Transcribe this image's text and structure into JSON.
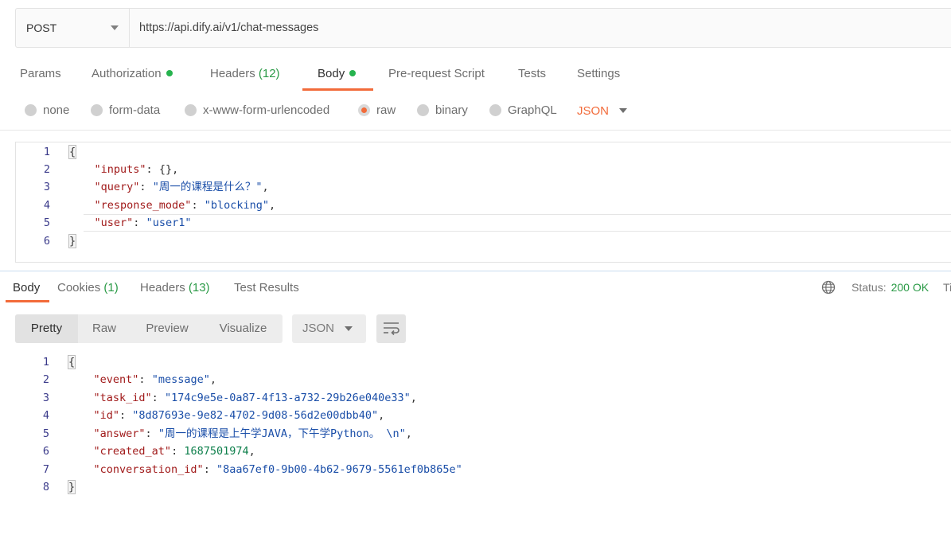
{
  "request": {
    "method": "POST",
    "url": "https://api.dify.ai/v1/chat-messages"
  },
  "request_tabs": [
    {
      "label": "Params",
      "count": "",
      "dot": false,
      "active": false
    },
    {
      "label": "Authorization",
      "count": "",
      "dot": true,
      "active": false
    },
    {
      "label": "Headers",
      "count": "(12)",
      "dot": false,
      "active": false
    },
    {
      "label": "Body",
      "count": "",
      "dot": true,
      "active": true
    },
    {
      "label": "Pre-request Script",
      "count": "",
      "dot": false,
      "active": false
    },
    {
      "label": "Tests",
      "count": "",
      "dot": false,
      "active": false
    },
    {
      "label": "Settings",
      "count": "",
      "dot": false,
      "active": false
    }
  ],
  "body_types": [
    {
      "label": "none",
      "selected": false
    },
    {
      "label": "form-data",
      "selected": false
    },
    {
      "label": "x-www-form-urlencoded",
      "selected": false
    },
    {
      "label": "raw",
      "selected": true
    },
    {
      "label": "binary",
      "selected": false
    },
    {
      "label": "GraphQL",
      "selected": false
    }
  ],
  "body_format": "JSON",
  "request_body": {
    "line_numbers": [
      "1",
      "2",
      "3",
      "4",
      "5",
      "6"
    ],
    "lines": [
      {
        "open": "{"
      },
      {
        "key": "\"inputs\"",
        "sep": ": ",
        "value": "{}",
        "value_type": "p",
        "end": ","
      },
      {
        "key": "\"query\"",
        "sep": ": ",
        "value": "\"周一的课程是什么？\"",
        "value_type": "s",
        "end": ","
      },
      {
        "key": "\"response_mode\"",
        "sep": ": ",
        "value": "\"blocking\"",
        "value_type": "s",
        "end": ","
      },
      {
        "key": "\"user\"",
        "sep": ": ",
        "value": "\"user1\"",
        "value_type": "s",
        "end": ""
      },
      {
        "close": "}"
      }
    ]
  },
  "response_tabs": [
    {
      "label": "Body",
      "count": "",
      "active": true
    },
    {
      "label": "Cookies",
      "count": "(1)",
      "active": false
    },
    {
      "label": "Headers",
      "count": "(13)",
      "active": false
    },
    {
      "label": "Test Results",
      "count": "",
      "active": false
    }
  ],
  "status": {
    "label": "Status:",
    "value": "200 OK",
    "time_label": "Ti"
  },
  "view_modes": [
    "Pretty",
    "Raw",
    "Preview",
    "Visualize"
  ],
  "active_view": "Pretty",
  "response_format": "JSON",
  "response_body": {
    "line_numbers": [
      "1",
      "2",
      "3",
      "4",
      "5",
      "6",
      "7",
      "8"
    ],
    "lines": [
      {
        "open": "{"
      },
      {
        "key": "\"event\"",
        "sep": ": ",
        "value": "\"message\"",
        "value_type": "s",
        "end": ","
      },
      {
        "key": "\"task_id\"",
        "sep": ": ",
        "value": "\"174c9e5e-0a87-4f13-a732-29b26e040e33\"",
        "value_type": "s",
        "end": ","
      },
      {
        "key": "\"id\"",
        "sep": ": ",
        "value": "\"8d87693e-9e82-4702-9d08-56d2e00dbb40\"",
        "value_type": "s",
        "end": ","
      },
      {
        "key": "\"answer\"",
        "sep": ": ",
        "value": "\"周一的课程是上午学JAVA，下午学Python。 \\n\"",
        "value_type": "s",
        "end": ","
      },
      {
        "key": "\"created_at\"",
        "sep": ": ",
        "value": "1687501974",
        "value_type": "n",
        "end": ","
      },
      {
        "key": "\"conversation_id\"",
        "sep": ": ",
        "value": "\"8aa67ef0-9b00-4b62-9679-5561ef0b865e\"",
        "value_type": "s",
        "end": ""
      },
      {
        "close": "}"
      }
    ]
  },
  "colors": {
    "accent": "#f26b3a",
    "ok": "#2a9a46",
    "key": "#a11b1b",
    "string": "#1a4ea8",
    "number": "#0d7f4b"
  }
}
